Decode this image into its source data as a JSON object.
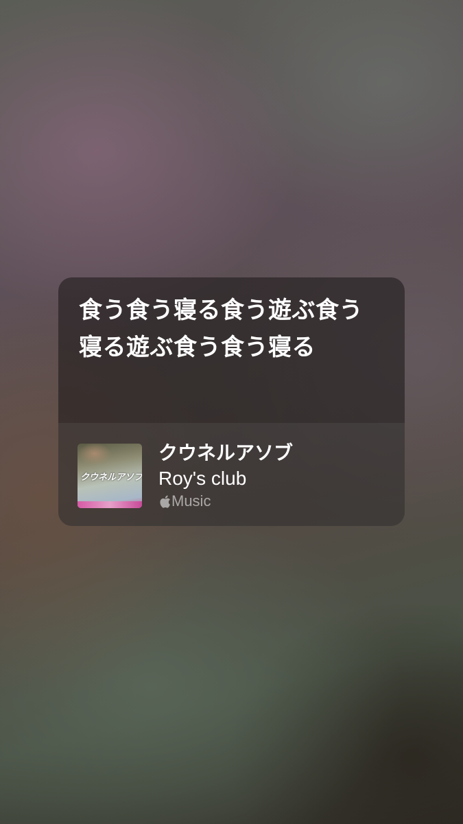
{
  "lyrics": {
    "lines": [
      "食う食う寝る食う遊ぶ食う",
      "寝る遊ぶ食う食う寝る"
    ]
  },
  "track": {
    "title": "クウネルアソブ",
    "artist": "Roy's club",
    "service_label": "Music",
    "service_icon": "apple-logo-icon",
    "artwork": {
      "title_text": "クウネルアソブ",
      "accent_color": "#d65aa5"
    }
  }
}
